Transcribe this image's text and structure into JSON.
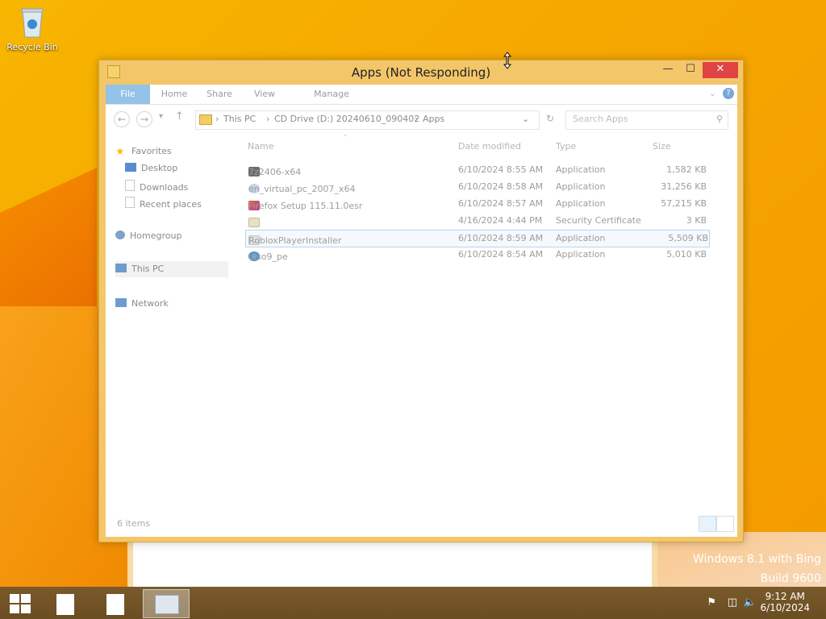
{
  "desktop": {
    "recycle_bin_label": "Recycle Bin",
    "watermark_line1": "Windows 8.1 with Bing",
    "watermark_line2": "Build 9600"
  },
  "window": {
    "title": "Apps (Not Responding)",
    "ribbon_tabs": [
      "File",
      "Home",
      "Share",
      "View",
      "Manage"
    ],
    "address": {
      "crumbs": [
        "This PC",
        "CD Drive (D:) 20240610_090402",
        "Apps"
      ],
      "search_placeholder": "Search Apps"
    },
    "nav_pane": {
      "favorites": "Favorites",
      "desktop": "Desktop",
      "downloads": "Downloads",
      "recent": "Recent places",
      "homegroup": "Homegroup",
      "this_pc": "This PC",
      "network": "Network"
    },
    "columns": {
      "name": "Name",
      "date": "Date modified",
      "type": "Type",
      "size": "Size"
    },
    "files": [
      {
        "name": "7z2406-x64",
        "date": "6/10/2024 8:55 AM",
        "type": "Application",
        "size": "1,582 KB"
      },
      {
        "name": "en_virtual_pc_2007_x64",
        "date": "6/10/2024 8:58 AM",
        "type": "Application",
        "size": "31,256 KB"
      },
      {
        "name": "Firefox Setup 115.11.0esr",
        "date": "6/10/2024 8:57 AM",
        "type": "Application",
        "size": "57,215 KB"
      },
      {
        "name": "",
        "date": "4/16/2024 4:44 PM",
        "type": "Security Certificate",
        "size": "3 KB"
      },
      {
        "name": "RobloxPlayerInstaller",
        "date": "6/10/2024 8:59 AM",
        "type": "Application",
        "size": "5,509 KB"
      },
      {
        "name": "uiso9_pe",
        "date": "6/10/2024 8:54 AM",
        "type": "Application",
        "size": "5,010 KB"
      }
    ],
    "status_text": "6 items"
  },
  "taskbar": {
    "time": "9:12 AM",
    "date": "6/10/2024"
  },
  "colors": {
    "accent": "#94c2e8",
    "close": "#e04343",
    "desktop": "#f6a800"
  }
}
